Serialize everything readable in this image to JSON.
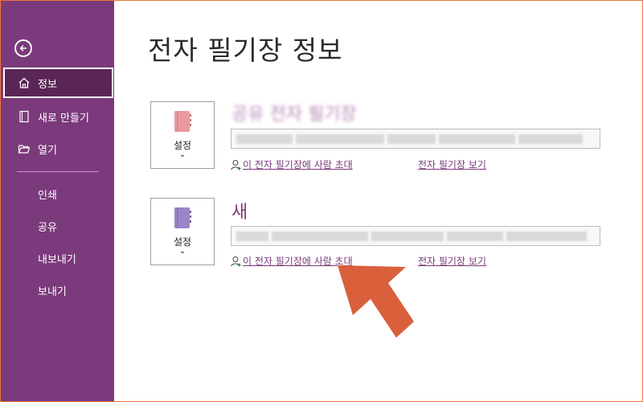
{
  "sidebar": {
    "back_icon": "back-arrow-icon",
    "items": [
      {
        "label": "정보",
        "icon": "home-icon",
        "active": true
      },
      {
        "label": "새로 만들기",
        "icon": "new-notebook-icon"
      },
      {
        "label": "열기",
        "icon": "folder-open-icon"
      },
      {
        "label": "인쇄"
      },
      {
        "label": "공유"
      },
      {
        "label": "내보내기"
      },
      {
        "label": "보내기"
      }
    ]
  },
  "main": {
    "title": "전자 필기장 정보",
    "notebooks": [
      {
        "name": "공유 전자 필기장",
        "settings_label": "설정",
        "chevron": "⌄",
        "path": "",
        "invite_label": "이 전자 필기장에 사람 초대",
        "view_label": "전자 필기장 보기",
        "book_color": "#e89aa0"
      },
      {
        "name": "새",
        "settings_label": "설정",
        "chevron": "⌄",
        "path": "",
        "invite_label": "이 전자 필기장에 사람 초대",
        "view_label": "전자 필기장 보기",
        "book_color": "#9b85c9"
      }
    ]
  },
  "colors": {
    "sidebar_bg": "#7b3a7c",
    "accent": "#7b3a7c",
    "annotation_arrow": "#d9603b"
  }
}
